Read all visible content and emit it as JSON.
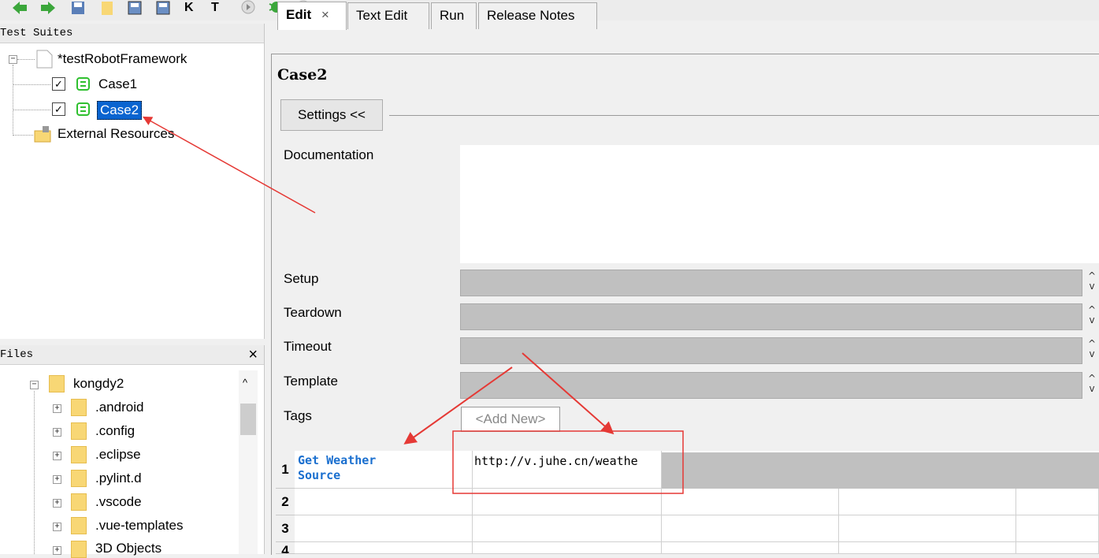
{
  "toolbar": {
    "icons": [
      "back-arrow-icon",
      "forward-arrow-icon",
      "save-icon",
      "open-folder-icon",
      "save-all-icon",
      "export-icon",
      "keyword-icon",
      "test-icon",
      "run-icon",
      "bug-icon",
      "stop-icon"
    ],
    "colors": {
      "arrows": "#3ba63b",
      "robot": "#2fc02f"
    }
  },
  "suites": {
    "title": "Test Suites",
    "root": "*testRobotFramework",
    "cases": [
      {
        "label": "Case1",
        "checked": true,
        "selected": false
      },
      {
        "label": "Case2",
        "checked": true,
        "selected": true
      }
    ],
    "external": "External Resources"
  },
  "files": {
    "title": "Files",
    "close": "×",
    "items": [
      "kongdy2",
      ".android",
      ".config",
      ".eclipse",
      ".pylint.d",
      ".vscode",
      ".vue-templates",
      "3D Objects"
    ]
  },
  "tabs": [
    {
      "label": "Edit",
      "active": true,
      "close": "×"
    },
    {
      "label": "Text Edit",
      "active": false
    },
    {
      "label": "Run",
      "active": false
    },
    {
      "label": "Release Notes",
      "active": false
    }
  ],
  "editor": {
    "case_title": "Case2",
    "settings_button": "Settings <<",
    "labels": {
      "documentation": "Documentation",
      "setup": "Setup",
      "teardown": "Teardown",
      "timeout": "Timeout",
      "template": "Template",
      "tags": "Tags"
    },
    "add_new": "<Add New>",
    "spinner_up": "^",
    "spinner_down": "v"
  },
  "grid": {
    "rows": [
      "1",
      "2",
      "3",
      "4"
    ],
    "keyword_line1": "Get Weather",
    "keyword_line2": "Source",
    "argument": "http://v.juhe.cn/weathe"
  },
  "annotation_color": "#e53935"
}
